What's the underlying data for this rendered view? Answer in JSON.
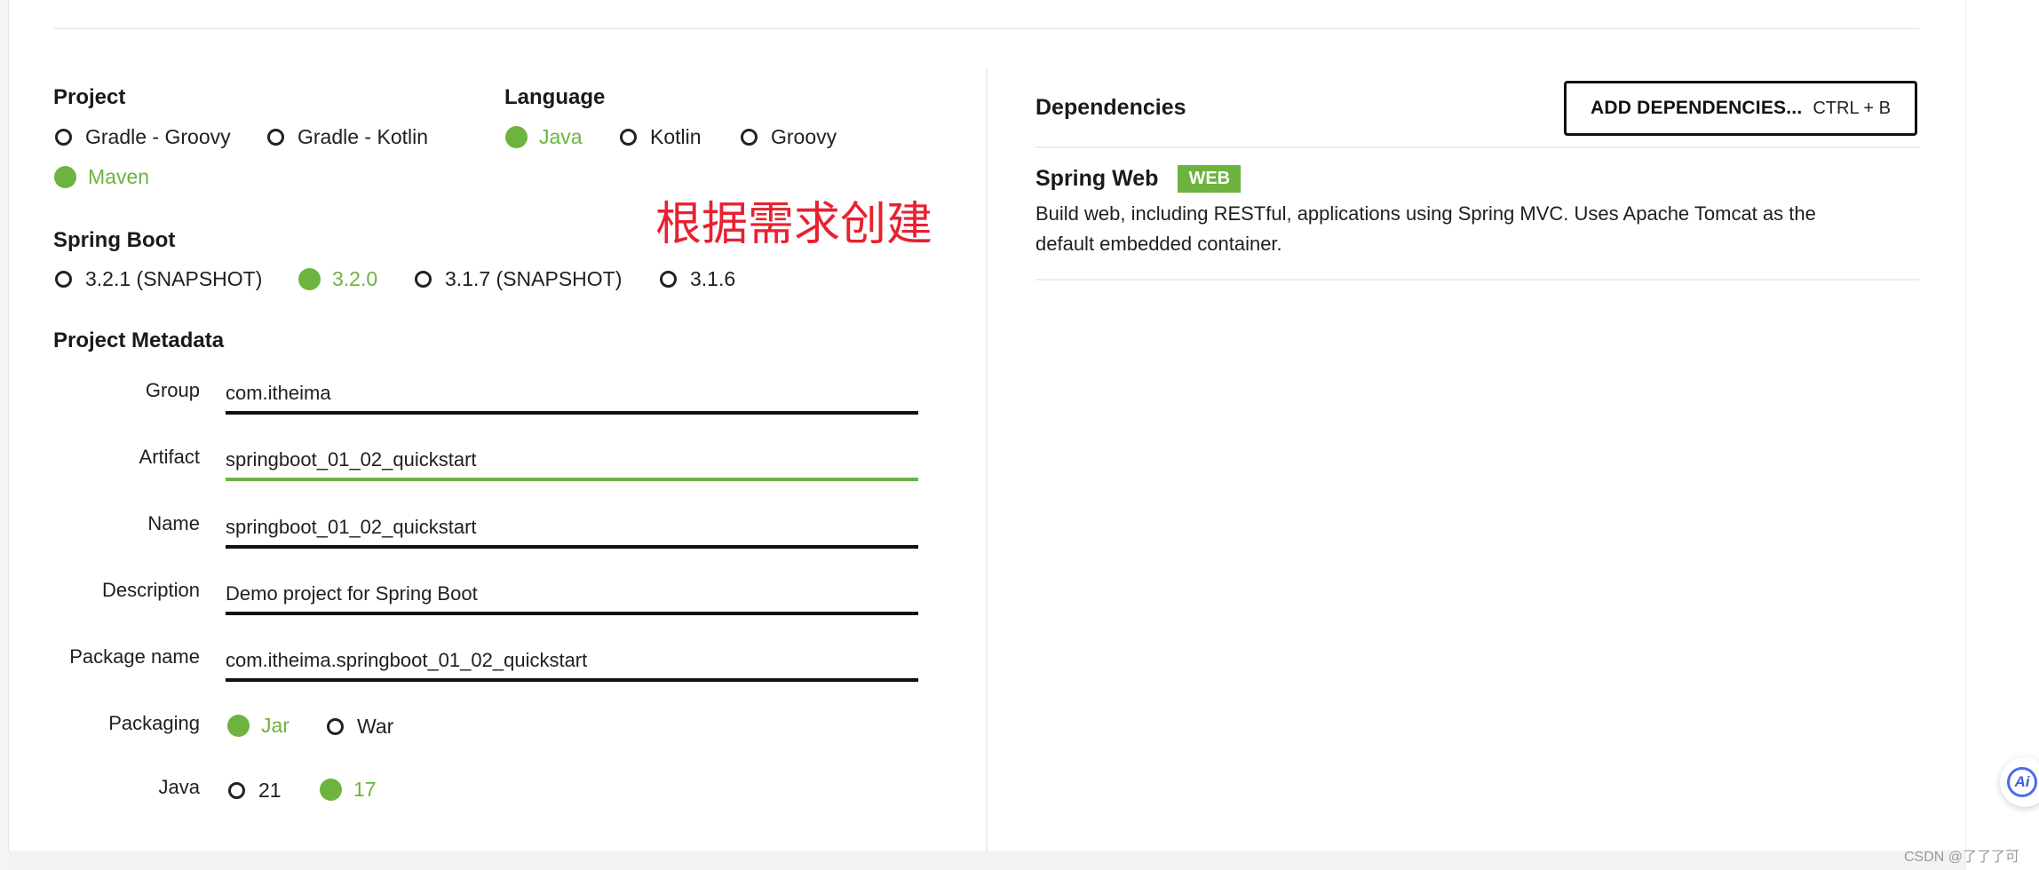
{
  "project": {
    "title": "Project",
    "options": [
      {
        "label": "Gradle - Groovy",
        "checked": false
      },
      {
        "label": "Gradle - Kotlin",
        "checked": false
      },
      {
        "label": "Maven",
        "checked": true
      }
    ]
  },
  "language": {
    "title": "Language",
    "options": [
      {
        "label": "Java",
        "checked": true
      },
      {
        "label": "Kotlin",
        "checked": false
      },
      {
        "label": "Groovy",
        "checked": false
      }
    ]
  },
  "spring_boot": {
    "title": "Spring Boot",
    "options": [
      {
        "label": "3.2.1 (SNAPSHOT)",
        "checked": false
      },
      {
        "label": "3.2.0",
        "checked": true
      },
      {
        "label": "3.1.7 (SNAPSHOT)",
        "checked": false
      },
      {
        "label": "3.1.6",
        "checked": false
      }
    ]
  },
  "annotation": "根据需求创建",
  "metadata": {
    "title": "Project Metadata",
    "fields": [
      {
        "label": "Group",
        "value": "com.itheima"
      },
      {
        "label": "Artifact",
        "value": "springboot_01_02_quickstart"
      },
      {
        "label": "Name",
        "value": "springboot_01_02_quickstart"
      },
      {
        "label": "Description",
        "value": "Demo project for Spring Boot"
      },
      {
        "label": "Package name",
        "value": "com.itheima.springboot_01_02_quickstart"
      }
    ],
    "packaging": {
      "label": "Packaging",
      "options": [
        {
          "label": "Jar",
          "checked": true
        },
        {
          "label": "War",
          "checked": false
        }
      ]
    },
    "java": {
      "label": "Java",
      "options": [
        {
          "label": "21",
          "checked": false
        },
        {
          "label": "17",
          "checked": true
        }
      ]
    }
  },
  "dependencies": {
    "title": "Dependencies",
    "add_button_label": "ADD DEPENDENCIES...",
    "add_button_shortcut": "CTRL + B",
    "items": [
      {
        "name": "Spring Web",
        "badge": "WEB",
        "description": "Build web, including RESTful, applications using Spring MVC. Uses Apache Tomcat as the default embedded container."
      }
    ]
  },
  "floating_button": {
    "icon": "ai-assistant-icon",
    "text": "Ai"
  },
  "watermark": "CSDN @了了了可",
  "colors": {
    "accent": "#6db33f",
    "annotation": "#e8202f",
    "ai_blue": "#4a6cf0"
  }
}
